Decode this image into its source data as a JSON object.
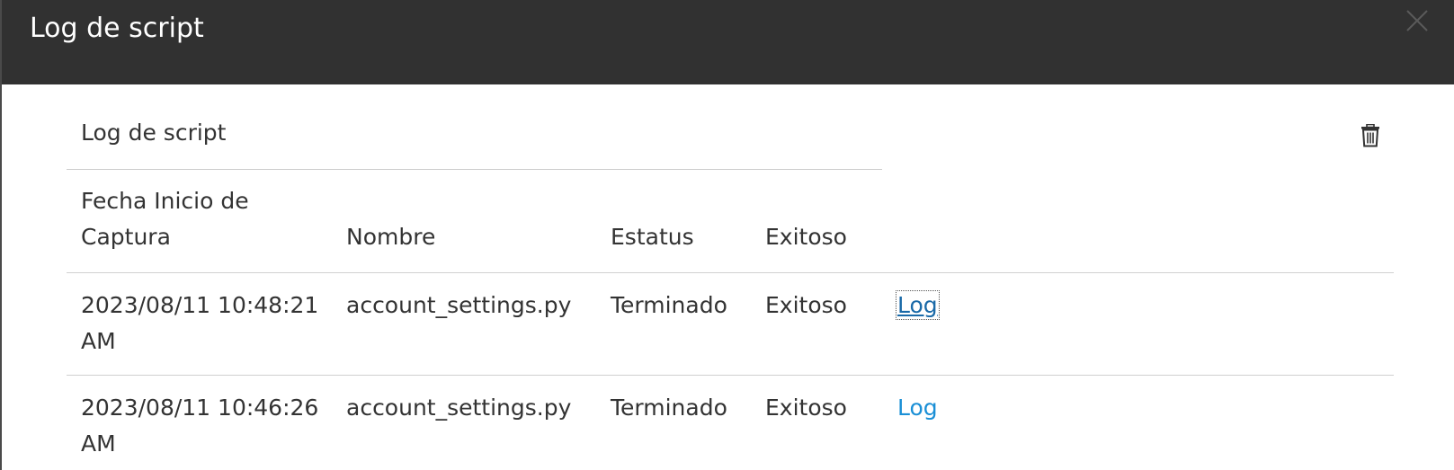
{
  "dialog": {
    "title": "Log de script",
    "close_icon": "close-icon"
  },
  "card": {
    "title": "Log de script",
    "delete_icon": "trash-icon"
  },
  "table": {
    "headers": {
      "date": "Fecha Inicio de Captura",
      "name": "Nombre",
      "status": "Estatus",
      "success": "Exitoso"
    },
    "rows": [
      {
        "date": "2023/08/11 10:48:21 AM",
        "name": "account_settings.py",
        "status": "Terminado",
        "success": "Exitoso",
        "link": "Log"
      },
      {
        "date": "2023/08/11 10:46:26 AM",
        "name": "account_settings.py",
        "status": "Terminado",
        "success": "Exitoso",
        "link": "Log"
      }
    ]
  },
  "colors": {
    "header_bg": "#313131",
    "link": "#1a8fd6",
    "text": "#333333"
  }
}
